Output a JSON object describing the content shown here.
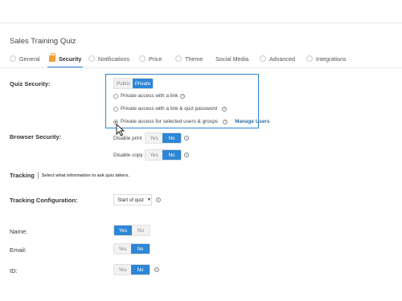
{
  "page": {
    "title": "Sales Training Quiz"
  },
  "tabs": [
    {
      "label": "General"
    },
    {
      "label": "Security",
      "active": true
    },
    {
      "label": "Notifications"
    },
    {
      "label": "Price"
    },
    {
      "label": "Theme"
    },
    {
      "label": "Social Media"
    },
    {
      "label": "Advanced"
    },
    {
      "label": "Integrations"
    }
  ],
  "quiz_security": {
    "label": "Quiz Security:",
    "toggle": {
      "left": "Public",
      "right": "Private",
      "selected": "Private"
    },
    "options": [
      {
        "label": "Private access with a link",
        "selected": false
      },
      {
        "label": "Private access with a link & quiz password",
        "selected": false
      },
      {
        "label": "Private access for selected users & groups",
        "selected": true
      }
    ],
    "manage_users": "Manage Users"
  },
  "browser_security": {
    "label": "Browser Security:",
    "disable_print": {
      "label": "Disable print",
      "yes": "Yes",
      "no": "No",
      "selected": "No"
    },
    "disable_copy": {
      "label": "Disable copy",
      "yes": "Yes",
      "no": "No",
      "selected": "No"
    }
  },
  "tracking": {
    "label": "Tracking",
    "hint": "Select what information to ask quiz takers."
  },
  "tracking_config": {
    "label": "Tracking Configuration:",
    "select_value": "Start of quiz"
  },
  "fields": {
    "name": {
      "label": "Name:",
      "yes": "Yes",
      "no": "No",
      "selected": "Yes"
    },
    "email": {
      "label": "Email:",
      "yes": "Yes",
      "no": "No",
      "selected": "No"
    },
    "id": {
      "label": "ID:",
      "yes": "Yes",
      "no": "No",
      "selected": "No"
    }
  },
  "colors": {
    "accent": "#2e86d6",
    "lock": "#f0a030",
    "link": "#2e6da4"
  }
}
